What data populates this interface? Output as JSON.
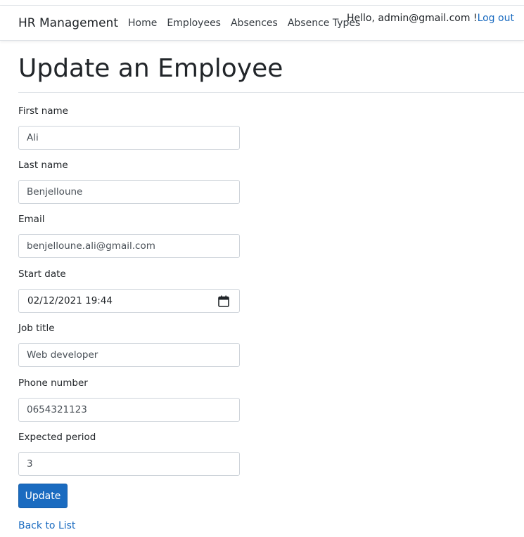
{
  "nav": {
    "brand": "HR Management",
    "links": [
      "Home",
      "Employees",
      "Absences",
      "Absence Types"
    ],
    "greeting": "Hello, admin@gmail.com !",
    "logout": "Log out"
  },
  "page": {
    "title": "Update an Employee"
  },
  "form": {
    "first_name": {
      "label": "First name",
      "value": "Ali"
    },
    "last_name": {
      "label": "Last name",
      "value": "Benjelloune"
    },
    "email": {
      "label": "Email",
      "value": "benjelloune.ali@gmail.com"
    },
    "start_date": {
      "label": "Start date",
      "value": "02/12/2021 19:44"
    },
    "job_title": {
      "label": "Job title",
      "value": "Web developer"
    },
    "phone_number": {
      "label": "Phone number",
      "value": "0654321123"
    },
    "expected_period": {
      "label": "Expected period",
      "value": "3"
    },
    "submit_label": "Update"
  },
  "footer": {
    "back_link": "Back to List"
  },
  "colors": {
    "link": "#1a6bc0",
    "primary_button": "#1a6bc0"
  },
  "icons": {
    "date_picker": "calendar-icon"
  }
}
